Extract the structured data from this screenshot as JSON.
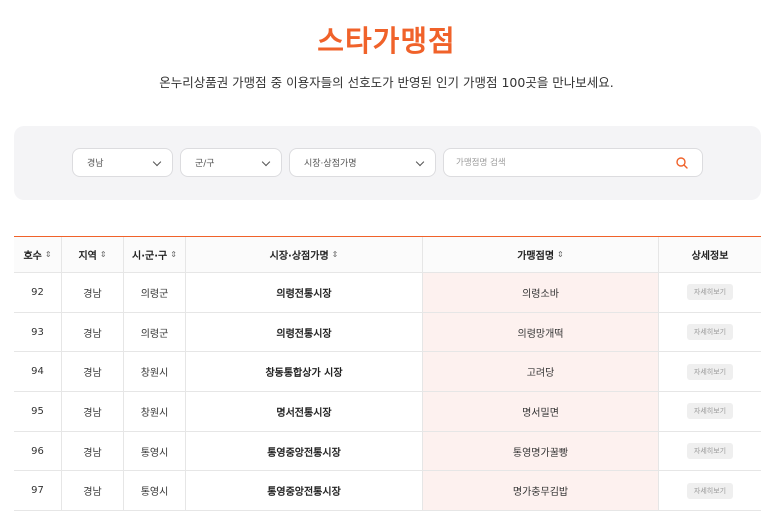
{
  "header": {
    "title": "스타가맹점",
    "subtitle": "온누리상품권 가맹점 중 이용자들의 선호도가 반영된 인기 가맹점 100곳을 만나보세요."
  },
  "filters": {
    "region": "경남",
    "district": "군/구",
    "market": "시장·상점가명",
    "search_placeholder": "가맹점명 검색"
  },
  "table": {
    "headers": {
      "no": "호수",
      "region": "지역",
      "district": "시·군·구",
      "market": "시장·상점가명",
      "store": "가맹점명",
      "detail": "상세정보"
    },
    "sort_icon": "⇕",
    "detail_label": "자세히보기",
    "rows": [
      {
        "no": "92",
        "region": "경남",
        "district": "의령군",
        "market": "의령전통시장",
        "store": "의령소바"
      },
      {
        "no": "93",
        "region": "경남",
        "district": "의령군",
        "market": "의령전통시장",
        "store": "의령망개떡"
      },
      {
        "no": "94",
        "region": "경남",
        "district": "창원시",
        "market": "창동통합상가 시장",
        "store": "고려당"
      },
      {
        "no": "95",
        "region": "경남",
        "district": "창원시",
        "market": "명서전통시장",
        "store": "명서밀면"
      },
      {
        "no": "96",
        "region": "경남",
        "district": "통영시",
        "market": "통영중앙전통시장",
        "store": "통영명가꿀빵"
      },
      {
        "no": "97",
        "region": "경남",
        "district": "통영시",
        "market": "통영중앙전통시장",
        "store": "명가충무김밥"
      }
    ]
  },
  "colors": {
    "accent": "#f0622a",
    "highlight_column": "#fdf1ef"
  }
}
